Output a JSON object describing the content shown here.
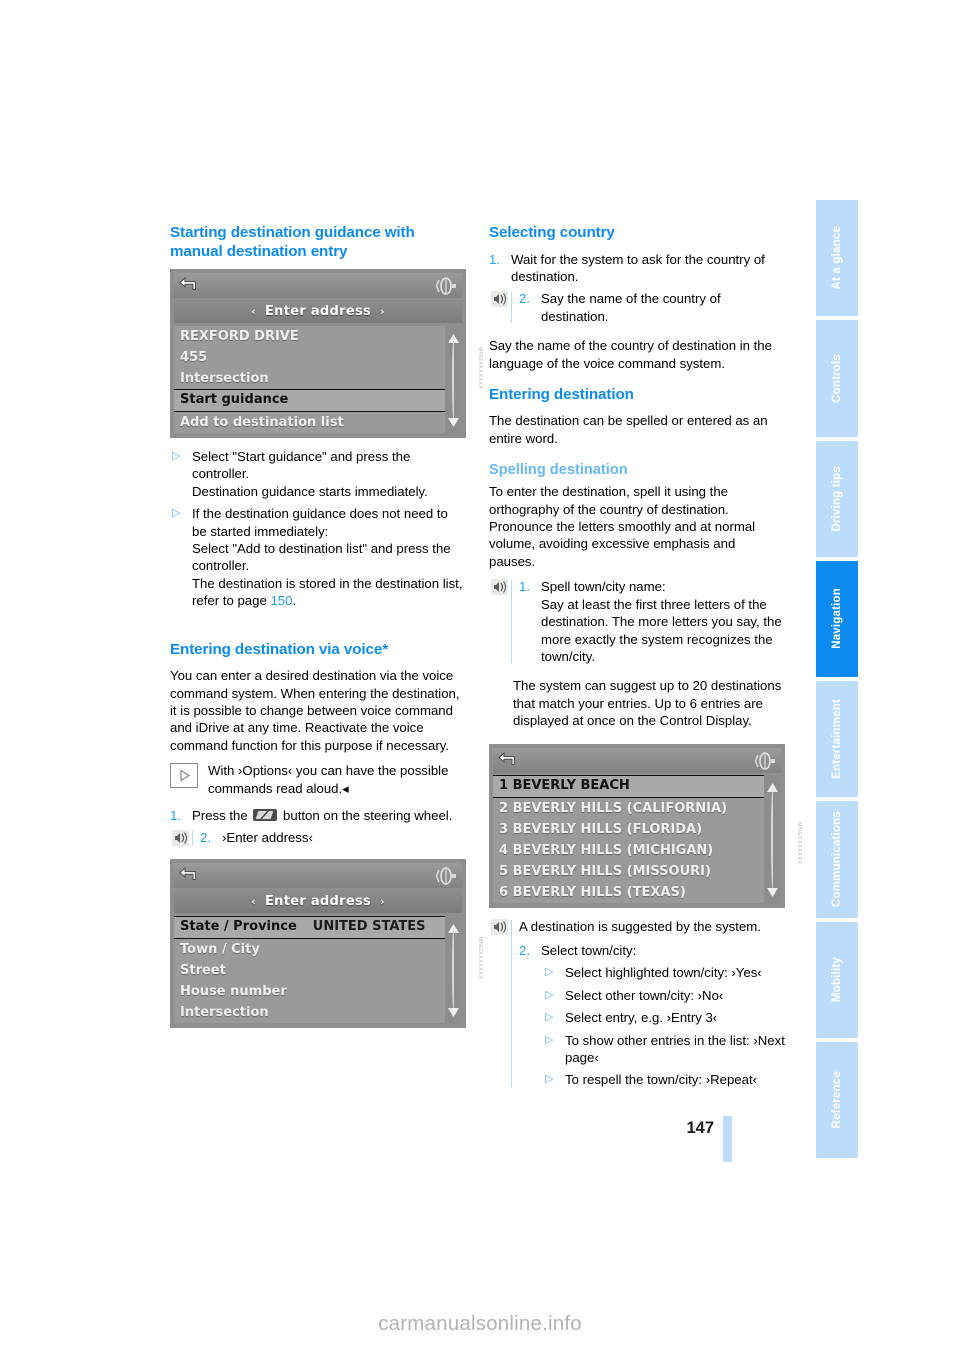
{
  "page": {
    "number": "147",
    "watermark": "carmanualsonline.info"
  },
  "sidebar": {
    "tabs": [
      {
        "label": "At a glance",
        "active": false
      },
      {
        "label": "Controls",
        "active": false
      },
      {
        "label": "Driving tips",
        "active": false
      },
      {
        "label": "Navigation",
        "active": true
      },
      {
        "label": "Entertainment",
        "active": false
      },
      {
        "label": "Communications",
        "active": false
      },
      {
        "label": "Mobility",
        "active": false
      },
      {
        "label": "Reference",
        "active": false
      }
    ]
  },
  "left": {
    "heading": "Starting destination guidance with manual destination entry",
    "display1": {
      "title": "Enter address",
      "arrow_left": "‹",
      "arrow_right": "›",
      "caption": "MNGXXXXXXX",
      "items": [
        {
          "label": "REXFORD DRIVE",
          "value": "",
          "selected": false
        },
        {
          "label": "455",
          "value": "",
          "selected": false
        },
        {
          "label": "Intersection",
          "value": "",
          "selected": false
        },
        {
          "label": "Start guidance",
          "value": "",
          "selected": true
        },
        {
          "label": "Add to destination list",
          "value": "",
          "selected": false
        }
      ]
    },
    "bullets": [
      "Select \"Start guidance\" and press the controller.\nDestination guidance starts immediately.",
      "If the destination guidance does not need to be started immediately:\nSelect \"Add to destination list\" and press the controller.\nThe destination is stored in the destination list, refer to page "
    ],
    "bullet2_page_ref": "150",
    "bullet2_tail": ".",
    "heading2": "Entering destination via voice*",
    "para1": "You can enter a desired destination via the voice command system. When entering the destination, it is possible to change between voice command and iDrive at any time. Reactivate the voice command function for this purpose if necessary.",
    "hint": "With ›Options‹ you can have the possible commands read aloud.◂",
    "step1_num": "1.",
    "step1_pre": "Press the ",
    "step1_post": " button on the steering wheel.",
    "step2_num": "2.",
    "step2_text": "›Enter address‹",
    "display2": {
      "title": "Enter address",
      "caption": "MNGXXXXXXX",
      "items": [
        {
          "label": "State / Province",
          "value": "UNITED STATES",
          "selected": true
        },
        {
          "label": "Town / City",
          "value": "",
          "selected": false
        },
        {
          "label": "Street",
          "value": "",
          "selected": false
        },
        {
          "label": "House number",
          "value": "",
          "selected": false
        },
        {
          "label": "Intersection",
          "value": "",
          "selected": false
        }
      ]
    }
  },
  "right": {
    "heading1": "Selecting country",
    "sc_step1_num": "1.",
    "sc_step1_text": "Wait for the system to ask for the country of destination.",
    "sc_step2_num": "2.",
    "sc_step2_text": "Say the name of the country of destination.",
    "sc_para": "Say the name of the country of destination in the language of the voice command system.",
    "heading2": "Entering destination",
    "ed_para": "The destination can be spelled or entered as an entire word.",
    "subheading": "Spelling destination",
    "sp_para": "To enter the destination, spell it using the orthography of the country of destination. Pronounce the letters smoothly and at normal volume, avoiding excessive emphasis and pauses.",
    "sp_step1_num": "1.",
    "sp_step1_text": "Spell town/city name:\nSay at least the first three letters of the destination. The more letters you say, the more exactly the system recognizes the town/city.",
    "sp_para2": "The system can suggest up to 20 destinations that match your entries. Up to 6 entries are displayed at once on the Control Display.",
    "display3": {
      "caption": "MNGXXXXXXX",
      "items": [
        {
          "label": "1 BEVERLY BEACH",
          "value": "",
          "selected": true
        },
        {
          "label": "2 BEVERLY HILLS (CALIFORNIA)",
          "value": "",
          "selected": false
        },
        {
          "label": "3 BEVERLY HILLS (FLORIDA)",
          "value": "",
          "selected": false
        },
        {
          "label": "4 BEVERLY HILLS (MICHIGAN)",
          "value": "",
          "selected": false
        },
        {
          "label": "5 BEVERLY HILLS (MISSOURI)",
          "value": "",
          "selected": false
        },
        {
          "label": "6 BEVERLY HILLS (TEXAS)",
          "value": "",
          "selected": false
        }
      ]
    },
    "suggest_text": "A destination is suggested by the system.",
    "sel_step_num": "2.",
    "sel_step_text": "Select town/city:",
    "sel_bullets": [
      "Select highlighted town/city: ›Yes‹",
      "Select other town/city: ›No‹",
      "Select entry, e.g. ›Entry 3‹",
      "To show other entries in the list: ›Next page‹",
      "To respell the town/city: ›Repeat‹"
    ]
  },
  "colors": {
    "accent": "#0b8bf0",
    "accent_light": "#63b8f5",
    "tab_inactive": "#bcdcfb",
    "display_gray": "#8f8f8f"
  }
}
